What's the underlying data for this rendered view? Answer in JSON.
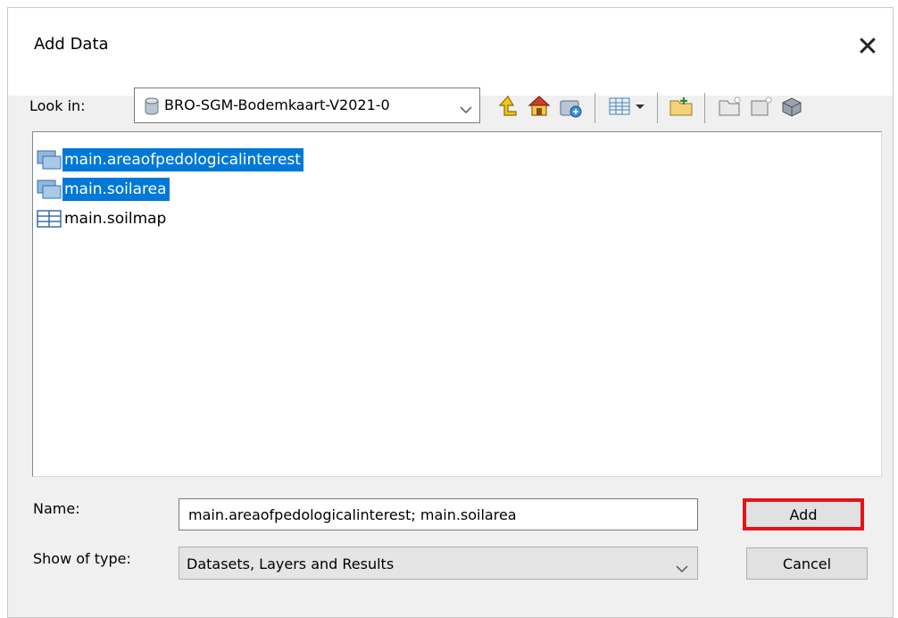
{
  "dialog": {
    "title": "Add Data",
    "close_label": "✕"
  },
  "lookin": {
    "label": "Look in:",
    "value": "BRO-SGM-Bodemkaart-V2021-0",
    "icon": "database-icon"
  },
  "toolbar": {
    "buttons": [
      {
        "name": "up-one-level",
        "icon": "up-arrow-icon"
      },
      {
        "name": "home",
        "icon": "home-icon"
      },
      {
        "name": "go-to-default",
        "icon": "default-geodatabase-icon"
      },
      {
        "name": "view-options",
        "icon": "list-view-icon"
      },
      {
        "name": "connect-to-folder",
        "icon": "connect-folder-icon"
      },
      {
        "name": "new-folder",
        "icon": "new-folder-icon"
      },
      {
        "name": "new-database",
        "icon": "new-database-icon"
      },
      {
        "name": "catalog",
        "icon": "catalog-icon"
      }
    ]
  },
  "files": [
    {
      "name": "main.areaofpedologicalinterest",
      "icon": "polygon-feature-class-icon",
      "selected": true
    },
    {
      "name": "main.soilarea",
      "icon": "polygon-feature-class-icon",
      "selected": true
    },
    {
      "name": "main.soilmap",
      "icon": "table-icon",
      "selected": false
    }
  ],
  "name_field": {
    "label": "Name:",
    "value": "main.areaofpedologicalinterest; main.soilarea"
  },
  "type_field": {
    "label": "Show of type:",
    "value": "Datasets, Layers and Results"
  },
  "buttons": {
    "add": "Add",
    "cancel": "Cancel"
  },
  "colors": {
    "selection": "#0078d7",
    "highlight": "#e3141b"
  }
}
